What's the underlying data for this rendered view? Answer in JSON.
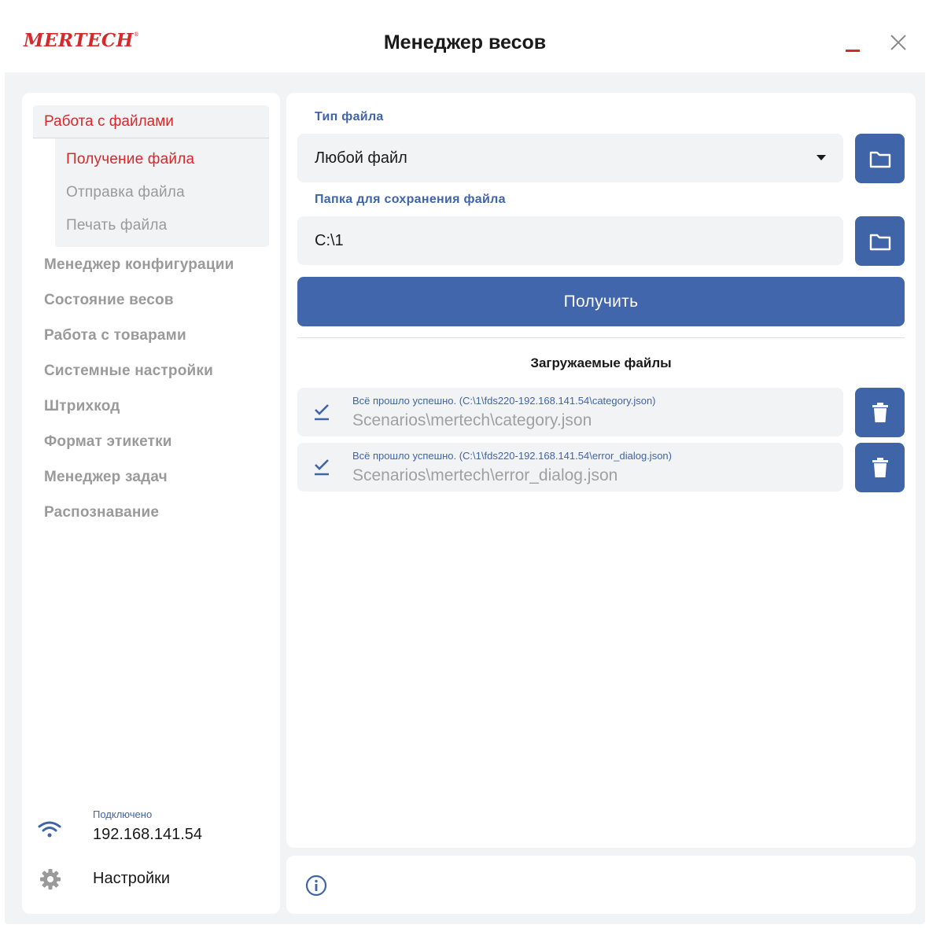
{
  "app": {
    "logo": "MERTECH",
    "logo_mark": "®",
    "title": "Менеджер весов"
  },
  "window_controls": {
    "minimize_icon": "minimize-icon",
    "close_icon": "close-icon",
    "accent": "#d42a2a"
  },
  "sidebar": {
    "section": {
      "label": "Работа с файлами",
      "items": [
        {
          "label": "Получение файла",
          "active": true
        },
        {
          "label": "Отправка файла",
          "active": false
        },
        {
          "label": "Печать файла",
          "active": false
        }
      ]
    },
    "items": [
      {
        "label": "Менеджер конфигурации"
      },
      {
        "label": "Состояние весов"
      },
      {
        "label": "Работа с товарами"
      },
      {
        "label": "Системные настройки"
      },
      {
        "label": "Штрихкод"
      },
      {
        "label": "Формат этикетки"
      },
      {
        "label": "Менеджер задач"
      },
      {
        "label": "Распознавание"
      }
    ],
    "connection": {
      "status": "Подключено",
      "ip": "192.168.141.54",
      "icon": "wifi-icon"
    },
    "settings": {
      "label": "Настройки",
      "icon": "gear-icon"
    }
  },
  "main": {
    "file_type": {
      "label": "Тип файла",
      "value": "Любой файл"
    },
    "save_folder": {
      "label": "Папка для сохранения файла",
      "value": "C:\\1"
    },
    "get_button": "Получить",
    "files_title": "Загружаемые файлы",
    "files": [
      {
        "status": "Всё прошло успешно. (C:\\1\\fds220-192.168.141.54\\category.json)",
        "path": "Scenarios\\mertech\\category.json"
      },
      {
        "status": "Всё прошло успешно. (C:\\1\\fds220-192.168.141.54\\error_dialog.json)",
        "path": "Scenarios\\mertech\\error_dialog.json"
      }
    ]
  },
  "colors": {
    "accent_red": "#d42a2a",
    "primary_blue": "#4266ab",
    "muted_text": "#9a9a9a",
    "panel_bg": "#f2f3f5"
  }
}
